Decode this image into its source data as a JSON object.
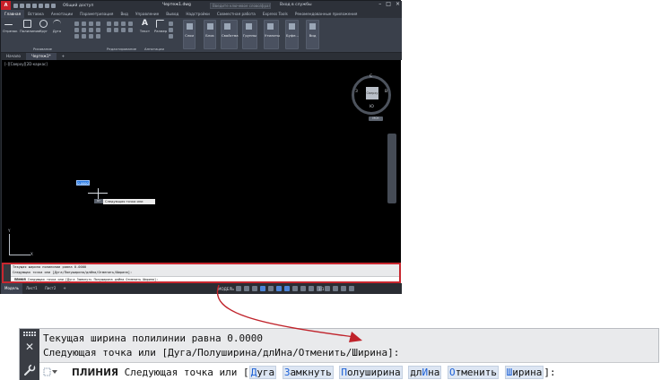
{
  "app": {
    "logo_text": "A",
    "share_label": "Общий доступ",
    "document_title": "Чертеж1.dwg",
    "search_placeholder": "Введите ключевое слово/фразу",
    "sign_in": "Вход в службы"
  },
  "ribbon_tabs": [
    "Главная",
    "Вставка",
    "Аннотации",
    "Параметризация",
    "Вид",
    "Управление",
    "Вывод",
    "Надстройки",
    "Совместная работа",
    "Express Tools",
    "Рекомендованные приложения"
  ],
  "ribbon": {
    "draw_tools": [
      "Отрезок",
      "Полилиния",
      "Круг",
      "Дуга"
    ],
    "annotation_tools": [
      "Текст",
      "Размер"
    ],
    "panels": [
      "Слои",
      "Блок",
      "Свойства",
      "Группы",
      "Утилиты",
      "Буфе...",
      "Вид"
    ],
    "group_labels": [
      "Рисование",
      "Редактирование",
      "Аннотации"
    ]
  },
  "file_tabs": [
    "Начало",
    "Чертеж1*"
  ],
  "drawing": {
    "view_label": "[–][Сверху][2D-каркас]",
    "viewcube_face": "Сверху",
    "compass": {
      "n": "С",
      "s": "Ю",
      "w": "З",
      "e": "В"
    },
    "wcs_badge": "МСК",
    "dynamic_input_value": "0.0000",
    "coord_value": "87",
    "prompt_tooltip": "Следующая точка или",
    "ucs_x": "X",
    "ucs_y": "Y"
  },
  "command_line": {
    "history": [
      "Текущая ширина полилинии равна 0.0000",
      "Следующая точка или [Дуга/Полуширина/длИна/Отменить/Ширина]:"
    ],
    "command_name": "ПЛИНИЯ",
    "prompt": "Следующая точка или",
    "options": [
      {
        "pre": "",
        "hotkey": "Д",
        "post": "уга"
      },
      {
        "pre": "",
        "hotkey": "З",
        "post": "амкнуть"
      },
      {
        "pre": "",
        "hotkey": "П",
        "post": "олуширина"
      },
      {
        "pre": "дл",
        "hotkey": "И",
        "post": "на"
      },
      {
        "pre": "",
        "hotkey": "О",
        "post": "тменить"
      },
      {
        "pre": "",
        "hotkey": "Ш",
        "post": "ирина"
      }
    ],
    "suffix": "]:"
  },
  "layout_tabs": [
    "Модель",
    "Лист1",
    "Лист2"
  ],
  "status": {
    "model_label": "МОДЕЛЬ",
    "scale": "1:1"
  },
  "colors": {
    "highlight_border": "#c8272f",
    "option_hotkey": "#1a5fd6",
    "arrow": "#c0232b"
  }
}
